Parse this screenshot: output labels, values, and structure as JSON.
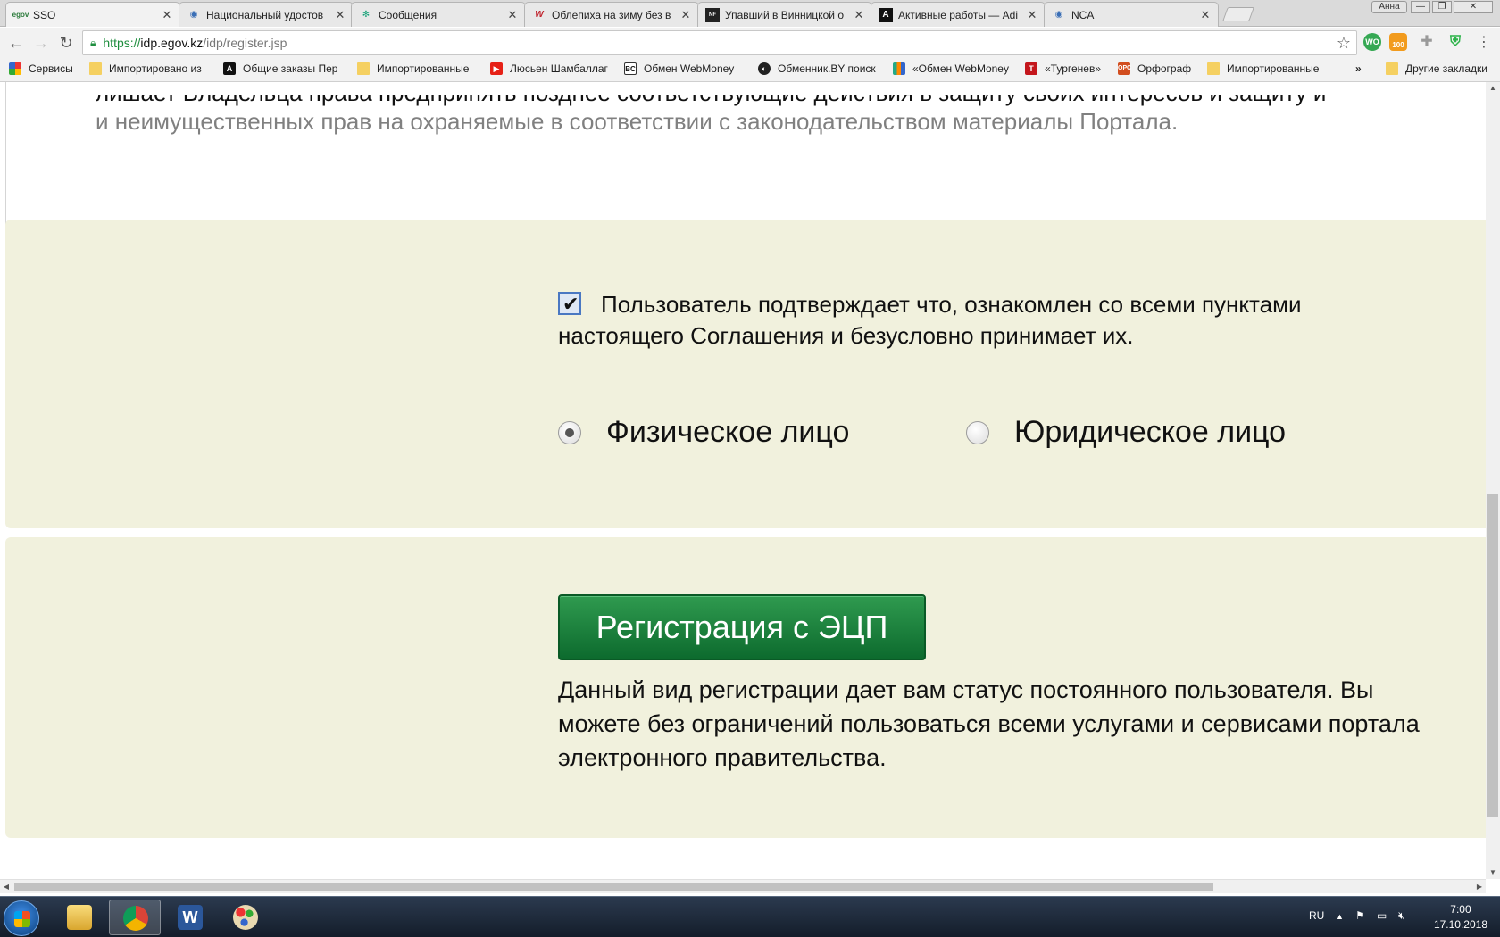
{
  "browser": {
    "tabs": [
      {
        "title": "SSO",
        "favicon": "egov-favicon",
        "active": true
      },
      {
        "title": "Национальный удостов",
        "favicon": "globe-favicon"
      },
      {
        "title": "Сообщения",
        "favicon": "snowflake-favicon"
      },
      {
        "title": "Облепиха на зиму без в",
        "favicon": "w-favicon"
      },
      {
        "title": "Упавший в Винницкой о",
        "favicon": "newsfront-favicon"
      },
      {
        "title": "Активные работы — Adi",
        "favicon": "a-favicon"
      },
      {
        "title": "NCA",
        "favicon": "globe-favicon"
      }
    ],
    "user_chip": "Анна",
    "url": {
      "scheme": "https://",
      "host": "idp.egov.kz",
      "path": "/idp/register.jsp"
    },
    "extensions": [
      {
        "name": "wot-icon",
        "label": "WO",
        "color": "#35a853"
      },
      {
        "name": "feed-icon",
        "label": "100",
        "color": "#f29b1d"
      },
      {
        "name": "puzzle-icon",
        "label": "",
        "color": "#9a9a9a"
      },
      {
        "name": "shield-icon",
        "label": "",
        "color": "#2db34a"
      }
    ],
    "bookmarks": [
      {
        "label": "Сервисы",
        "icon": "apps-icon"
      },
      {
        "label": "Импортировано из",
        "icon": "folder-icon"
      },
      {
        "label": "Общие заказы Пер",
        "icon": "a-icon"
      },
      {
        "label": "Импортированные",
        "icon": "folder-icon"
      },
      {
        "label": "Люсьен Шамбаллаг",
        "icon": "youtube-icon"
      },
      {
        "label": "Обмен WebMoney",
        "icon": "bc-icon"
      },
      {
        "label": "Обменник.BY поиск",
        "icon": "exchanger-icon"
      },
      {
        "label": "«Обмен WebMoney",
        "icon": "chart-icon"
      },
      {
        "label": "«Тургенев»",
        "icon": "t-icon"
      },
      {
        "label": "Орфограф",
        "icon": "ors-icon"
      },
      {
        "label": "Импортированные",
        "icon": "folder-icon"
      }
    ],
    "bookmarks_overflow": "»",
    "other_bookmarks": "Другие закладки"
  },
  "page": {
    "agreement_tail_line1": "лишает Владельца права предпринять позднее соответствующие действия в защиту своих интересов и защиту и",
    "agreement_tail_line2": "и неимущественных прав на охраняемые в соответствии с законодательством материалы Портала.",
    "accept_checkbox_checked": true,
    "accept_text": "Пользователь подтверждает что, ознакомлен со всеми пунктами настоящего Соглашения и безусловно принимает их.",
    "person_type": {
      "individual": "Физическое лицо",
      "legal": "Юридическое лицо",
      "selected": "individual"
    },
    "register_button": "Регистрация с ЭЦП",
    "register_description": "Данный вид регистрации дает вам статус постоянного пользователя. Вы можете без ограничений пользоваться всеми услугами и сервисами портала электронного правительства."
  },
  "taskbar": {
    "apps": [
      "explorer-icon",
      "chrome-icon",
      "word-icon",
      "paint-icon"
    ],
    "language": "RU",
    "time": "7:00",
    "date": "17.10.2018"
  }
}
